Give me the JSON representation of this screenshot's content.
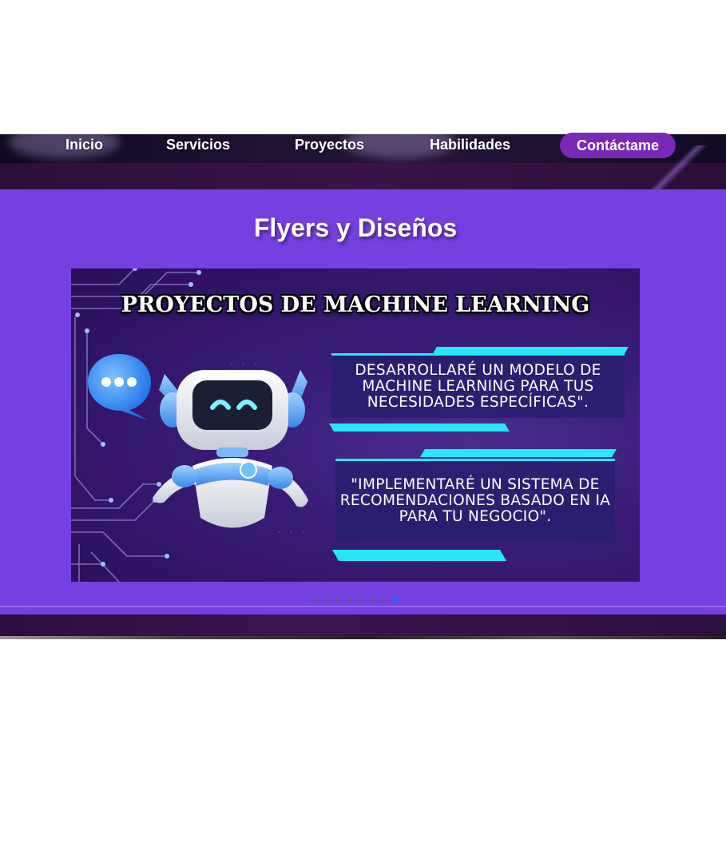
{
  "nav": {
    "items": [
      {
        "label": "Inicio"
      },
      {
        "label": "Servicios"
      },
      {
        "label": "Proyectos"
      },
      {
        "label": "Habilidades"
      }
    ],
    "cta_label": "Contáctame"
  },
  "section": {
    "title": "Flyers y Diseños"
  },
  "flyer": {
    "title": "PROYECTOS DE MACHINE LEARNING",
    "panel1": "DESARROLLARÉ UN MODELO DE MACHINE LEARNING PARA TUS NECESIDADES ESPECÍFICAS\".",
    "panel2": "\"IMPLEMENTARÉ UN SISTEMA DE RECOMENDACIONES BASADO EN IA PARA TU NEGOCIO\"."
  },
  "carousel": {
    "slide_count": 8,
    "active_index": 7
  },
  "colors": {
    "section_bg": "#7440e0",
    "cta_bg": "#7a28b8",
    "accent_cyan": "#29e6f4",
    "dot_active": "#1f6bff"
  }
}
